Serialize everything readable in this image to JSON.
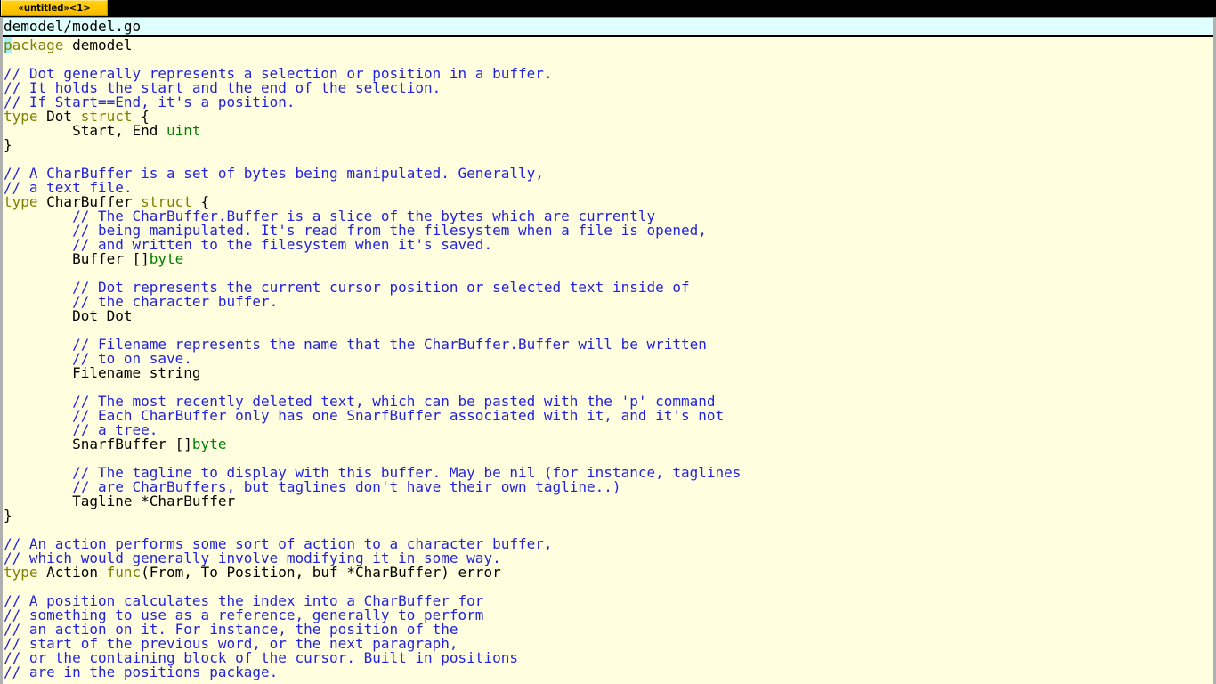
{
  "window": {
    "tab_label": "«untitled»<1>",
    "path": "demodel/model.go",
    "colors": {
      "tab_bg": "#ffc800",
      "tab_fg": "#000000",
      "titlebar_bg": "#000000",
      "pathbar_bg": "#e0ffff",
      "editor_bg": "#ffffe0",
      "keyword": "#808000",
      "comment": "#2222dd",
      "type": "#008000",
      "identifier": "#000000",
      "cursor": "#a8f0f0",
      "frame": "#b0b0b0"
    }
  },
  "editor": {
    "language": "go",
    "cursor": {
      "line": 1,
      "column": 1,
      "char": "p"
    },
    "lines": [
      {
        "n": 1,
        "text": "package demodel",
        "tokens": [
          {
            "t": "p",
            "c": "cur"
          },
          {
            "t": "ackage",
            "c": "kw"
          },
          {
            "t": " demodel",
            "c": "id"
          }
        ]
      },
      {
        "n": 2,
        "text": "",
        "tokens": []
      },
      {
        "n": 3,
        "text": "// Dot generally represents a selection or position in a buffer.",
        "tokens": [
          {
            "t": "// Dot generally represents a selection or position in a buffer.",
            "c": "cm"
          }
        ]
      },
      {
        "n": 4,
        "text": "// It holds the start and the end of the selection.",
        "tokens": [
          {
            "t": "// It holds the start and the end of the selection.",
            "c": "cm"
          }
        ]
      },
      {
        "n": 5,
        "text": "// If Start==End, it's a position.",
        "tokens": [
          {
            "t": "// If Start==End, it's a position.",
            "c": "cm"
          }
        ]
      },
      {
        "n": 6,
        "text": "type Dot struct {",
        "tokens": [
          {
            "t": "type",
            "c": "kw"
          },
          {
            "t": " Dot ",
            "c": "id"
          },
          {
            "t": "struct",
            "c": "kw"
          },
          {
            "t": " {",
            "c": "id"
          }
        ]
      },
      {
        "n": 7,
        "text": "        Start, End uint",
        "tokens": [
          {
            "t": "        Start, End ",
            "c": "id"
          },
          {
            "t": "uint",
            "c": "ty"
          }
        ]
      },
      {
        "n": 8,
        "text": "}",
        "tokens": [
          {
            "t": "}",
            "c": "id"
          }
        ]
      },
      {
        "n": 9,
        "text": "",
        "tokens": []
      },
      {
        "n": 10,
        "text": "// A CharBuffer is a set of bytes being manipulated. Generally,",
        "tokens": [
          {
            "t": "// A CharBuffer is a set of bytes being manipulated. Generally,",
            "c": "cm"
          }
        ]
      },
      {
        "n": 11,
        "text": "// a text file.",
        "tokens": [
          {
            "t": "// a text file.",
            "c": "cm"
          }
        ]
      },
      {
        "n": 12,
        "text": "type CharBuffer struct {",
        "tokens": [
          {
            "t": "type",
            "c": "kw"
          },
          {
            "t": " CharBuffer ",
            "c": "id"
          },
          {
            "t": "struct",
            "c": "kw"
          },
          {
            "t": " {",
            "c": "id"
          }
        ]
      },
      {
        "n": 13,
        "text": "        // The CharBuffer.Buffer is a slice of the bytes which are currently",
        "tokens": [
          {
            "t": "        ",
            "c": "id"
          },
          {
            "t": "// The CharBuffer.Buffer is a slice of the bytes which are currently",
            "c": "cm"
          }
        ]
      },
      {
        "n": 14,
        "text": "        // being manipulated. It's read from the filesystem when a file is opened,",
        "tokens": [
          {
            "t": "        ",
            "c": "id"
          },
          {
            "t": "// being manipulated. It's read from the filesystem when a file is opened,",
            "c": "cm"
          }
        ]
      },
      {
        "n": 15,
        "text": "        // and written to the filesystem when it's saved.",
        "tokens": [
          {
            "t": "        ",
            "c": "id"
          },
          {
            "t": "// and written to the filesystem when it's saved.",
            "c": "cm"
          }
        ]
      },
      {
        "n": 16,
        "text": "        Buffer []byte",
        "tokens": [
          {
            "t": "        Buffer []",
            "c": "id"
          },
          {
            "t": "byte",
            "c": "ty"
          }
        ]
      },
      {
        "n": 17,
        "text": "",
        "tokens": []
      },
      {
        "n": 18,
        "text": "        // Dot represents the current cursor position or selected text inside of",
        "tokens": [
          {
            "t": "        ",
            "c": "id"
          },
          {
            "t": "// Dot represents the current cursor position or selected text inside of",
            "c": "cm"
          }
        ]
      },
      {
        "n": 19,
        "text": "        // the character buffer.",
        "tokens": [
          {
            "t": "        ",
            "c": "id"
          },
          {
            "t": "// the character buffer.",
            "c": "cm"
          }
        ]
      },
      {
        "n": 20,
        "text": "        Dot Dot",
        "tokens": [
          {
            "t": "        Dot Dot",
            "c": "id"
          }
        ]
      },
      {
        "n": 21,
        "text": "",
        "tokens": []
      },
      {
        "n": 22,
        "text": "        // Filename represents the name that the CharBuffer.Buffer will be written",
        "tokens": [
          {
            "t": "        ",
            "c": "id"
          },
          {
            "t": "// Filename represents the name that the CharBuffer.Buffer will be written",
            "c": "cm"
          }
        ]
      },
      {
        "n": 23,
        "text": "        // to on save.",
        "tokens": [
          {
            "t": "        ",
            "c": "id"
          },
          {
            "t": "// to on save.",
            "c": "cm"
          }
        ]
      },
      {
        "n": 24,
        "text": "        Filename string",
        "tokens": [
          {
            "t": "        Filename string",
            "c": "id"
          }
        ]
      },
      {
        "n": 25,
        "text": "",
        "tokens": []
      },
      {
        "n": 26,
        "text": "        // The most recently deleted text, which can be pasted with the 'p' command",
        "tokens": [
          {
            "t": "        ",
            "c": "id"
          },
          {
            "t": "// The most recently deleted text, which can be pasted with the 'p' command",
            "c": "cm"
          }
        ]
      },
      {
        "n": 27,
        "text": "        // Each CharBuffer only has one SnarfBuffer associated with it, and it's not",
        "tokens": [
          {
            "t": "        ",
            "c": "id"
          },
          {
            "t": "// Each CharBuffer only has one SnarfBuffer associated with it, and it's not",
            "c": "cm"
          }
        ]
      },
      {
        "n": 28,
        "text": "        // a tree.",
        "tokens": [
          {
            "t": "        ",
            "c": "id"
          },
          {
            "t": "// a tree.",
            "c": "cm"
          }
        ]
      },
      {
        "n": 29,
        "text": "        SnarfBuffer []byte",
        "tokens": [
          {
            "t": "        SnarfBuffer []",
            "c": "id"
          },
          {
            "t": "byte",
            "c": "ty"
          }
        ]
      },
      {
        "n": 30,
        "text": "",
        "tokens": []
      },
      {
        "n": 31,
        "text": "        // The tagline to display with this buffer. May be nil (for instance, taglines",
        "tokens": [
          {
            "t": "        ",
            "c": "id"
          },
          {
            "t": "// The tagline to display with this buffer. May be nil (for instance, taglines",
            "c": "cm"
          }
        ]
      },
      {
        "n": 32,
        "text": "        // are CharBuffers, but taglines don't have their own tagline..)",
        "tokens": [
          {
            "t": "        ",
            "c": "id"
          },
          {
            "t": "// are CharBuffers, but taglines don't have their own tagline..)",
            "c": "cm"
          }
        ]
      },
      {
        "n": 33,
        "text": "        Tagline *CharBuffer",
        "tokens": [
          {
            "t": "        Tagline *CharBuffer",
            "c": "id"
          }
        ]
      },
      {
        "n": 34,
        "text": "}",
        "tokens": [
          {
            "t": "}",
            "c": "id"
          }
        ]
      },
      {
        "n": 35,
        "text": "",
        "tokens": []
      },
      {
        "n": 36,
        "text": "// An action performs some sort of action to a character buffer,",
        "tokens": [
          {
            "t": "// An action performs some sort of action to a character buffer,",
            "c": "cm"
          }
        ]
      },
      {
        "n": 37,
        "text": "// which would generally involve modifying it in some way.",
        "tokens": [
          {
            "t": "// which would generally involve modifying it in some way.",
            "c": "cm"
          }
        ]
      },
      {
        "n": 38,
        "text": "type Action func(From, To Position, buf *CharBuffer) error",
        "tokens": [
          {
            "t": "type",
            "c": "kw"
          },
          {
            "t": " Action ",
            "c": "id"
          },
          {
            "t": "func",
            "c": "kw"
          },
          {
            "t": "(From, To Position, buf *CharBuffer) error",
            "c": "id"
          }
        ]
      },
      {
        "n": 39,
        "text": "",
        "tokens": []
      },
      {
        "n": 40,
        "text": "// A position calculates the index into a CharBuffer for",
        "tokens": [
          {
            "t": "// A position calculates the index into a CharBuffer for",
            "c": "cm"
          }
        ]
      },
      {
        "n": 41,
        "text": "// something to use as a reference, generally to perform",
        "tokens": [
          {
            "t": "// something to use as a reference, generally to perform",
            "c": "cm"
          }
        ]
      },
      {
        "n": 42,
        "text": "// an action on it. For instance, the position of the",
        "tokens": [
          {
            "t": "// an action on it. For instance, the position of the",
            "c": "cm"
          }
        ]
      },
      {
        "n": 43,
        "text": "// start of the previous word, or the next paragraph,",
        "tokens": [
          {
            "t": "// start of the previous word, or the next paragraph,",
            "c": "cm"
          }
        ]
      },
      {
        "n": 44,
        "text": "// or the containing block of the cursor. Built in positions",
        "tokens": [
          {
            "t": "// or the containing block of the cursor. Built in positions",
            "c": "cm"
          }
        ]
      },
      {
        "n": 45,
        "text": "// are in the positions package.",
        "tokens": [
          {
            "t": "// are in the positions package.",
            "c": "cm"
          }
        ]
      }
    ]
  }
}
